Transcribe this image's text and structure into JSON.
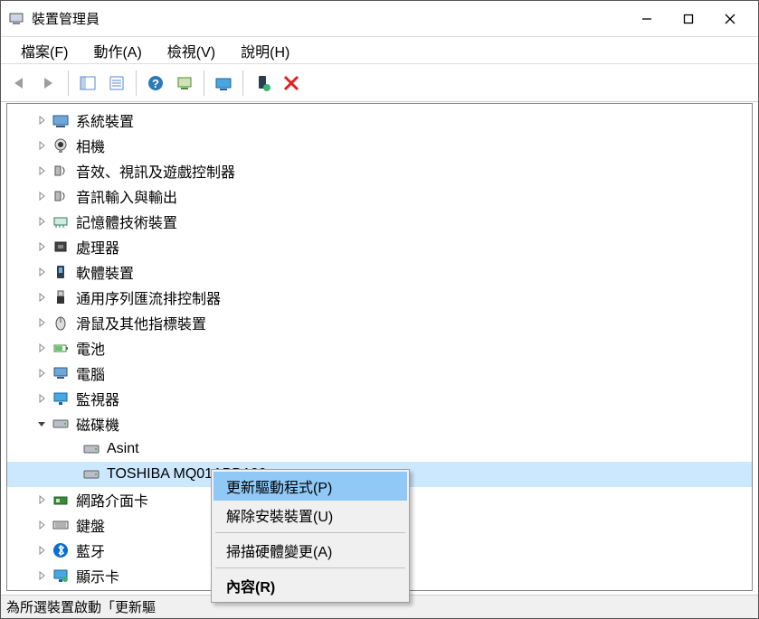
{
  "window": {
    "title": "裝置管理員"
  },
  "menubar": {
    "file": "檔案(F)",
    "action": "動作(A)",
    "view": "檢視(V)",
    "help": "說明(H)"
  },
  "tree": {
    "items": [
      {
        "label": "系統裝置",
        "expanded": false,
        "indent": 1,
        "icon": "system"
      },
      {
        "label": "相機",
        "expanded": false,
        "indent": 1,
        "icon": "camera"
      },
      {
        "label": "音效、視訊及遊戲控制器",
        "expanded": false,
        "indent": 1,
        "icon": "audio"
      },
      {
        "label": "音訊輸入與輸出",
        "expanded": false,
        "indent": 1,
        "icon": "audio"
      },
      {
        "label": "記憶體技術裝置",
        "expanded": false,
        "indent": 1,
        "icon": "memory"
      },
      {
        "label": "處理器",
        "expanded": false,
        "indent": 1,
        "icon": "cpu"
      },
      {
        "label": "軟體裝置",
        "expanded": false,
        "indent": 1,
        "icon": "software"
      },
      {
        "label": "通用序列匯流排控制器",
        "expanded": false,
        "indent": 1,
        "icon": "usb"
      },
      {
        "label": "滑鼠及其他指標裝置",
        "expanded": false,
        "indent": 1,
        "icon": "mouse"
      },
      {
        "label": "電池",
        "expanded": false,
        "indent": 1,
        "icon": "battery"
      },
      {
        "label": "電腦",
        "expanded": false,
        "indent": 1,
        "icon": "computer"
      },
      {
        "label": "監視器",
        "expanded": false,
        "indent": 1,
        "icon": "monitor"
      },
      {
        "label": "磁碟機",
        "expanded": true,
        "indent": 1,
        "icon": "disk"
      },
      {
        "label": "Asint",
        "expanded": null,
        "indent": 2,
        "icon": "disk"
      },
      {
        "label": "TOSHIBA MQ01ABD100",
        "expanded": null,
        "indent": 2,
        "icon": "disk",
        "selected": true
      },
      {
        "label": "網路介面卡",
        "expanded": false,
        "indent": 1,
        "icon": "network"
      },
      {
        "label": "鍵盤",
        "expanded": false,
        "indent": 1,
        "icon": "keyboard"
      },
      {
        "label": "藍牙",
        "expanded": false,
        "indent": 1,
        "icon": "bluetooth"
      },
      {
        "label": "顯示卡",
        "expanded": false,
        "indent": 1,
        "icon": "display"
      }
    ]
  },
  "context_menu": {
    "update_driver": "更新驅動程式(P)",
    "uninstall": "解除安裝裝置(U)",
    "scan_hw": "掃描硬體變更(A)",
    "properties": "內容(R)"
  },
  "statusbar": {
    "text": "為所選裝置啟動「更新驅"
  }
}
